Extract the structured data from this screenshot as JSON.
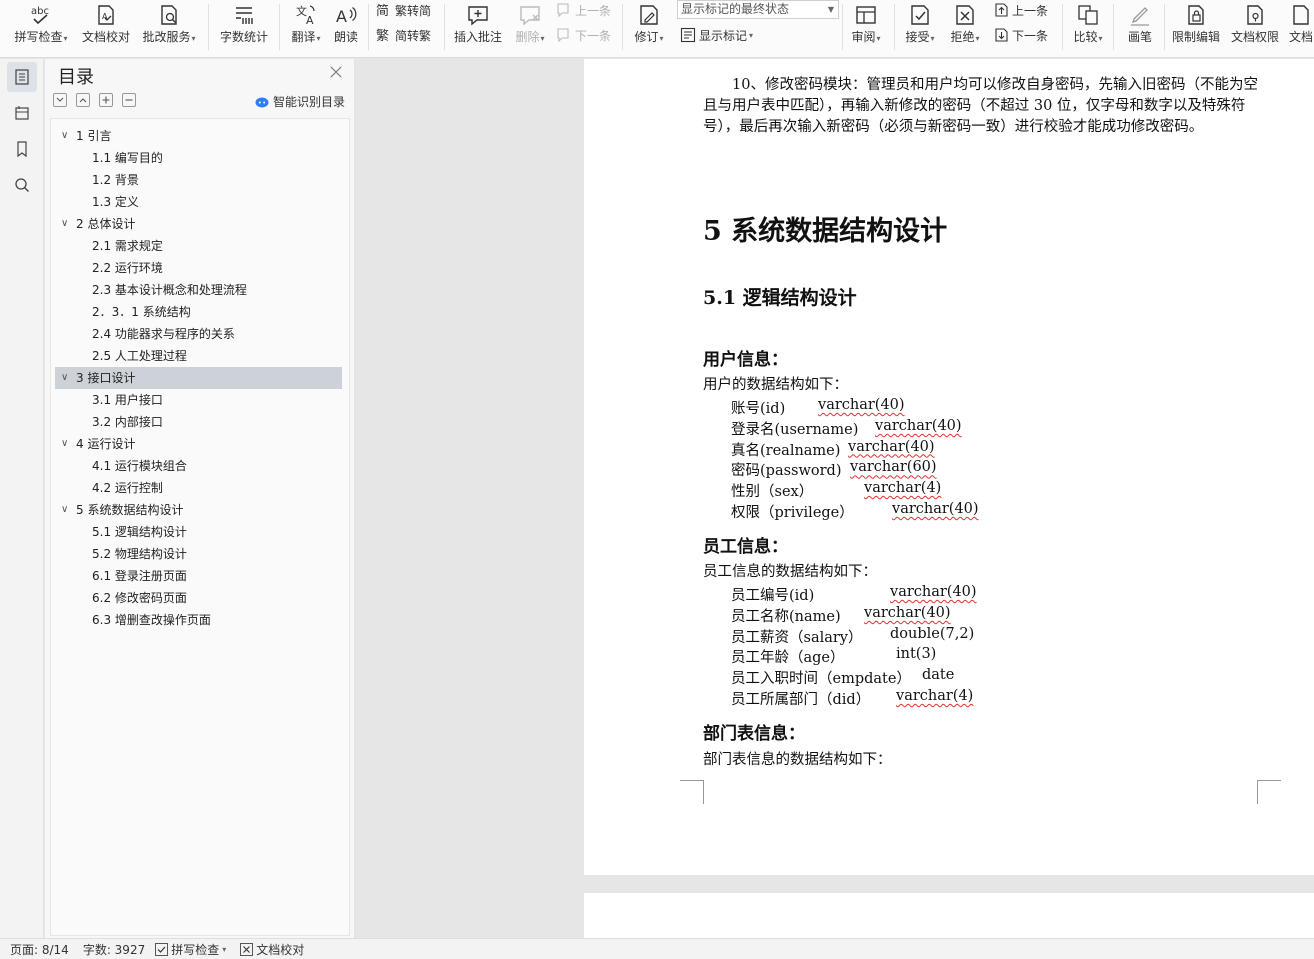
{
  "ribbon": {
    "spell_check": "拼写检查",
    "doc_proofread": "文档校对",
    "revise_service": "批改服务",
    "word_count": "字数统计",
    "translate": "翻译",
    "read_aloud": "朗读",
    "trad_to_simp": "繁转简",
    "simp_to_trad": "简转繁",
    "insert_comment": "插入批注",
    "delete": "删除",
    "prev_comment": "上一条",
    "next_comment": "下一条",
    "track_changes": "修订",
    "show_markup_state": "显示标记的最终状态",
    "show_markup": "显示标记",
    "review": "审阅",
    "accept": "接受",
    "reject": "拒绝",
    "prev_change": "上一条",
    "next_change": "下一条",
    "compare": "比较",
    "ink": "画笔",
    "restrict_edit": "限制编辑",
    "doc_permission": "文档权限",
    "doc_more": "文档"
  },
  "toc": {
    "title": "目录",
    "smart_label": "智能识别目录",
    "items": [
      {
        "label": "1 引言",
        "level": 1,
        "expanded": true
      },
      {
        "label": "1.1 编写目的",
        "level": 2
      },
      {
        "label": "1.2 背景",
        "level": 2
      },
      {
        "label": "1.3 定义",
        "level": 2
      },
      {
        "label": "2 总体设计",
        "level": 1,
        "expanded": true
      },
      {
        "label": "2.1 需求规定",
        "level": 2
      },
      {
        "label": "2.2 运行环境",
        "level": 2
      },
      {
        "label": "2.3 基本设计概念和处理流程",
        "level": 2
      },
      {
        "label": "2．3．1 系统结构",
        "level": 2
      },
      {
        "label": "2.4 功能器求与程序的关系",
        "level": 2
      },
      {
        "label": "2.5 人工处理过程",
        "level": 2
      },
      {
        "label": "3 接口设计",
        "level": 1,
        "expanded": true,
        "selected": true
      },
      {
        "label": "3.1 用户接口",
        "level": 2
      },
      {
        "label": "3.2 内部接口",
        "level": 2
      },
      {
        "label": "4 运行设计",
        "level": 1,
        "expanded": true
      },
      {
        "label": "4.1 运行模块组合",
        "level": 2
      },
      {
        "label": "4.2 运行控制",
        "level": 2
      },
      {
        "label": "5 系统数据结构设计",
        "level": 1,
        "expanded": true
      },
      {
        "label": "5.1 逻辑结构设计",
        "level": 2
      },
      {
        "label": "5.2  物理结构设计",
        "level": 2
      },
      {
        "label": "6.1 登录注册页面",
        "level": 2
      },
      {
        "label": "6.2 修改密码页面",
        "level": 2
      },
      {
        "label": "6.3 增删查改操作页面",
        "level": 2
      }
    ]
  },
  "doc": {
    "para_password": "10、修改密码模块：管理员和用户均可以修改自身密码，先输入旧密码（不能为空且与用户表中匹配），再输入新修改的密码（不超过 30 位，仅字母和数字以及特殊符号），最后再次输入新密码（必须与新密码一致）进行校验才能成功修改密码。",
    "h1": "5 系统数据结构设计",
    "h2": "5.1 逻辑结构设计",
    "user_heading": "用户信息：",
    "user_intro": "用户的数据结构如下：",
    "user_fields": [
      {
        "name": "账号(id)",
        "type": "varchar(40)"
      },
      {
        "name": "登录名(username)",
        "type": "varchar(40)"
      },
      {
        "name": "真名(realname)",
        "type": "varchar(40)"
      },
      {
        "name": "密码(password)",
        "type": "varchar(60)"
      },
      {
        "name": "性别（sex）",
        "type": "varchar(4)"
      },
      {
        "name": "权限（privilege）",
        "type": "varchar(40)"
      }
    ],
    "emp_heading": "员工信息：",
    "emp_intro": "员工信息的数据结构如下：",
    "emp_fields": [
      {
        "name": "员工编号(id)",
        "type": "varchar(40)"
      },
      {
        "name": "员工名称(name)",
        "type": "varchar(40)"
      },
      {
        "name": "员工薪资（salary）",
        "type": "double(7,2)"
      },
      {
        "name": "员工年龄（age）",
        "type": "int(3)"
      },
      {
        "name": "员工入职时间（empdate）",
        "type": "date"
      },
      {
        "name": "员工所属部门（did）",
        "type": "varchar(4)"
      }
    ],
    "dept_heading": "部门表信息：",
    "dept_intro": "部门表信息的数据结构如下："
  },
  "status": {
    "page": "页面: 8/14",
    "word_count": "字数: 3927",
    "spell_check": "拼写检查",
    "doc_proofread": "文档校对"
  },
  "colors": {
    "accent": "#2f7cf6",
    "selection": "#cdd2d9",
    "spell_squiggle": "#e03030"
  }
}
